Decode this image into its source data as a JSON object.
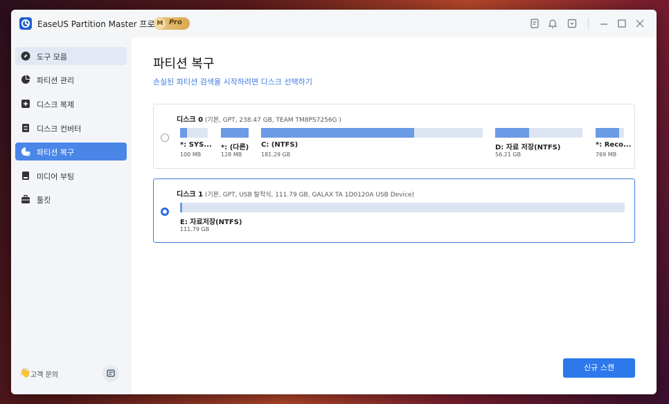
{
  "app": {
    "title": "EaseUS Partition Master 프로 버전",
    "badge_m": "M",
    "badge_text": "Pro",
    "accent": "#2d78ea"
  },
  "titlebar_icons": [
    "notes-icon",
    "bell-icon",
    "download-icon",
    "minimize-icon",
    "maximize-icon",
    "close-icon"
  ],
  "sidebar": {
    "items": [
      {
        "label": "도구 모음",
        "icon": "compass-icon",
        "state": "highlight"
      },
      {
        "label": "파티션 관리",
        "icon": "pie-chart-icon",
        "state": "normal"
      },
      {
        "label": "디스크 복제",
        "icon": "clone-icon",
        "state": "normal"
      },
      {
        "label": "디스크 컨버터",
        "icon": "disk-convert-icon",
        "state": "normal"
      },
      {
        "label": "파티션 복구",
        "icon": "partition-recover-icon",
        "state": "selected"
      },
      {
        "label": "미디어 부팅",
        "icon": "media-boot-icon",
        "state": "normal"
      },
      {
        "label": "툴킷",
        "icon": "toolbox-icon",
        "state": "normal"
      }
    ],
    "support_label": "고객 문의"
  },
  "main": {
    "title": "파티션 복구",
    "subtitle": "손실된 파티션 검색을 시작하려면 디스크 선택하기",
    "scan_button": "신규 스캔"
  },
  "disks": [
    {
      "name": "디스크 0",
      "meta": "(기본, GPT, 238.47 GB, TEAM TM8PS7256G )",
      "selected": false,
      "partitions": [
        {
          "name": "*: SYS...",
          "size": "100 MB",
          "fill": 0.25
        },
        {
          "name": "*: (다른)",
          "size": "128 MB",
          "fill": 1.0
        },
        {
          "name": "C: (NTFS)",
          "size": "181.29 GB",
          "fill": 0.69
        },
        {
          "name": "D: 자료 저장(NTFS)",
          "size": "56.21 GB",
          "fill": 0.39
        },
        {
          "name": "*: Reco...",
          "size": "769 MB",
          "fill": 0.83
        }
      ]
    },
    {
      "name": "디스크 1",
      "meta": "(기본, GPT, USB 탈착식, 111.79 GB, GALAX TA 1D0120A       USB Device)",
      "selected": true,
      "partitions": [
        {
          "name": "E: 자료저장(NTFS)",
          "size": "111.79 GB",
          "fill": 0.004
        }
      ]
    }
  ]
}
